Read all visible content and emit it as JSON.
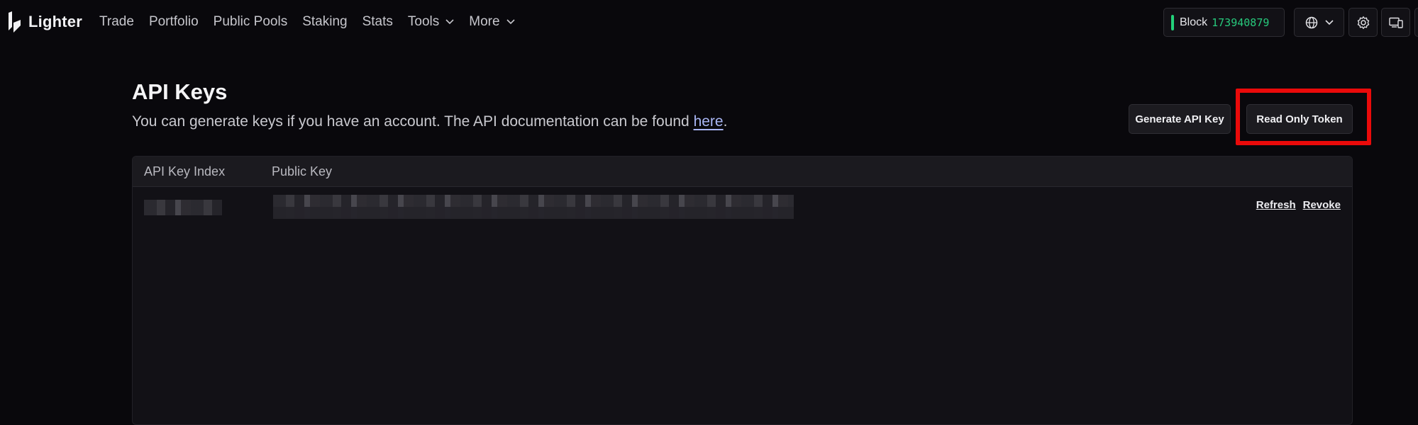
{
  "brand": {
    "name": "Lighter"
  },
  "nav": {
    "items": [
      {
        "label": "Trade"
      },
      {
        "label": "Portfolio"
      },
      {
        "label": "Public Pools"
      },
      {
        "label": "Staking"
      },
      {
        "label": "Stats"
      },
      {
        "label": "Tools",
        "has_dropdown": true
      },
      {
        "label": "More",
        "has_dropdown": true
      }
    ]
  },
  "status": {
    "block_label": "Block",
    "block_number": "173940879",
    "block_color": "#27c97c"
  },
  "toolbar_icons": [
    "globe-icon",
    "chevron-down-icon",
    "gear-icon",
    "devices-icon"
  ],
  "page": {
    "title": "API Keys",
    "subtitle_prefix": "You can generate keys if you have an account. The API documentation can be found ",
    "subtitle_link": "here",
    "subtitle_suffix": "."
  },
  "actions": {
    "generate_label": "Generate API Key",
    "readonly_label": "Read Only Token",
    "highlight_color": "#ea0a0a"
  },
  "table": {
    "headers": [
      "API Key Index",
      "Public Key"
    ],
    "rows": [
      {
        "index": "[redacted]",
        "public_key": "[redacted]",
        "refresh_label": "Refresh",
        "revoke_label": "Revoke"
      }
    ]
  }
}
